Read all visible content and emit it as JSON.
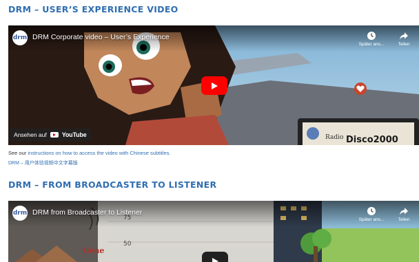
{
  "sections": [
    {
      "title": "DRM – USER’S EXPERIENCE VIDEO",
      "video": {
        "channel_logo": "drm",
        "title": "DRM Corporate video – User’s Experience",
        "watch_later_label": "Später ans...",
        "share_label": "Teilen",
        "watch_on_label": "Ansehen auf",
        "youtube_label": "YouTube",
        "screen_sign_1": "Radio",
        "screen_sign_2": "Disco2000"
      }
    },
    {
      "title": "DRM – FROM BROADCASTER TO LISTENER",
      "video": {
        "channel_logo": "drm",
        "title": "DRM from Broadcaster to Listener",
        "watch_later_label": "Später ans...",
        "share_label": "Teilen",
        "scene_text_1": "Gene",
        "scene_text_2": "50",
        "scene_text_3": "75"
      }
    }
  ],
  "captions": {
    "prefix": "See our ",
    "link": "instructions on how to access the video with Chinese subtitles.",
    "second_line": "DRM – 用户体验视频中文字幕版"
  },
  "colors": {
    "heading": "#2f6eb0",
    "link": "#2f6eb0",
    "play_button": "#ff0000"
  },
  "icons": [
    "clock-icon",
    "share-icon",
    "play-icon",
    "youtube-icon",
    "heart-icon"
  ]
}
